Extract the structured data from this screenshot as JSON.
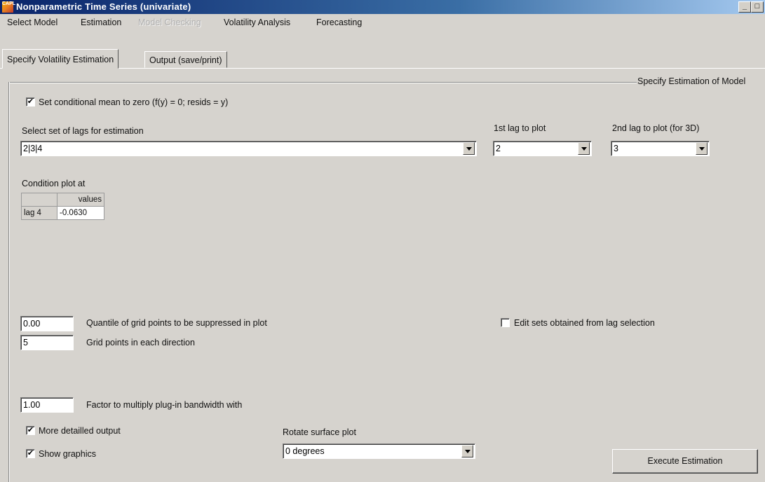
{
  "window": {
    "title": "Nonparametric Time Series (univariate)",
    "icon_text": "CAPL",
    "minimize": "_",
    "maximize": "□"
  },
  "menu": {
    "items": [
      {
        "label": "Select Model",
        "enabled": true
      },
      {
        "label": "Estimation",
        "enabled": true
      },
      {
        "label": "Model Checking",
        "enabled": false
      },
      {
        "label": "Volatility Analysis",
        "enabled": true
      },
      {
        "label": "Forecasting",
        "enabled": true
      }
    ]
  },
  "tabs": [
    {
      "label": "Specify Volatility Estimation",
      "active": true
    },
    {
      "label": "Output (save/print)",
      "active": false
    }
  ],
  "group": {
    "title": "Specify Estimation of Model"
  },
  "form": {
    "cond_mean_zero": {
      "label": "Set conditional mean to zero (f(y) = 0; resids = y)",
      "checked": true
    },
    "lags": {
      "label": "Select set of lags for estimation",
      "value": "2|3|4"
    },
    "lag1": {
      "label": "1st lag to plot",
      "value": "2"
    },
    "lag2": {
      "label": "2nd lag to plot (for 3D)",
      "value": "3"
    },
    "condition": {
      "label": "Condition plot at",
      "column_header": "values",
      "rows": [
        {
          "name": "lag 4",
          "value": "-0.0630"
        }
      ]
    },
    "quantile": {
      "value": "0.00",
      "label": "Quantile of grid points to be suppressed in plot"
    },
    "gridpoints": {
      "value": "5",
      "label": "Grid points in each direction"
    },
    "edit_sets": {
      "label": "Edit sets obtained from lag selection",
      "checked": false
    },
    "factor": {
      "value": "1.00",
      "label": "Factor to multiply plug-in bandwidth with"
    },
    "detailed_output": {
      "label": "More detailled output",
      "checked": true
    },
    "show_graphics": {
      "label": "Show graphics",
      "checked": true
    },
    "rotate": {
      "label": "Rotate surface plot",
      "value": "0 degrees"
    },
    "execute_label": "Execute Estimation"
  }
}
